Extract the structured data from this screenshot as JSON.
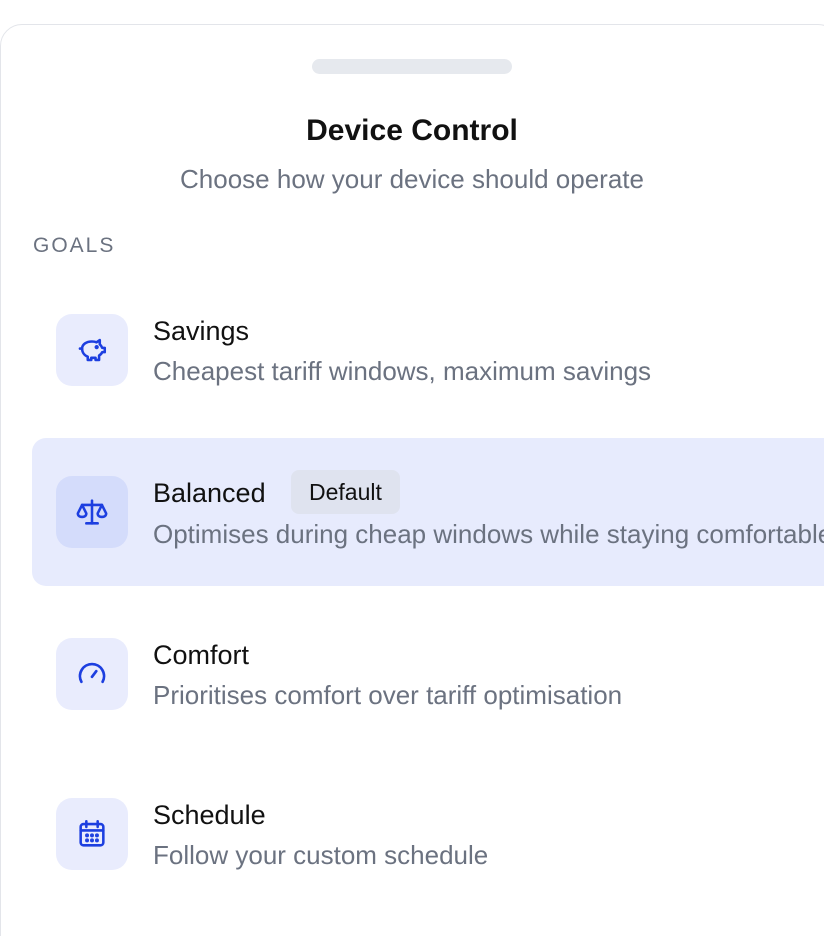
{
  "header": {
    "title": "Device Control",
    "subtitle": "Choose how your device should operate"
  },
  "section": {
    "label": "GOALS"
  },
  "accent_color": "#1d3fe0",
  "selected_background": "#e7ebfd",
  "options": [
    {
      "title": "Savings",
      "description": "Cheapest tariff windows, maximum savings",
      "icon": "piggy-bank-icon",
      "selected": false
    },
    {
      "title": "Balanced",
      "description": "Optimises during cheap windows while staying comfortable",
      "badge": "Default",
      "icon": "scale-icon",
      "selected": true
    },
    {
      "title": "Comfort",
      "description": "Prioritises comfort over tariff optimisation",
      "icon": "gauge-icon",
      "selected": false
    },
    {
      "title": "Schedule",
      "description": "Follow your custom schedule",
      "icon": "calendar-icon",
      "selected": false
    }
  ]
}
